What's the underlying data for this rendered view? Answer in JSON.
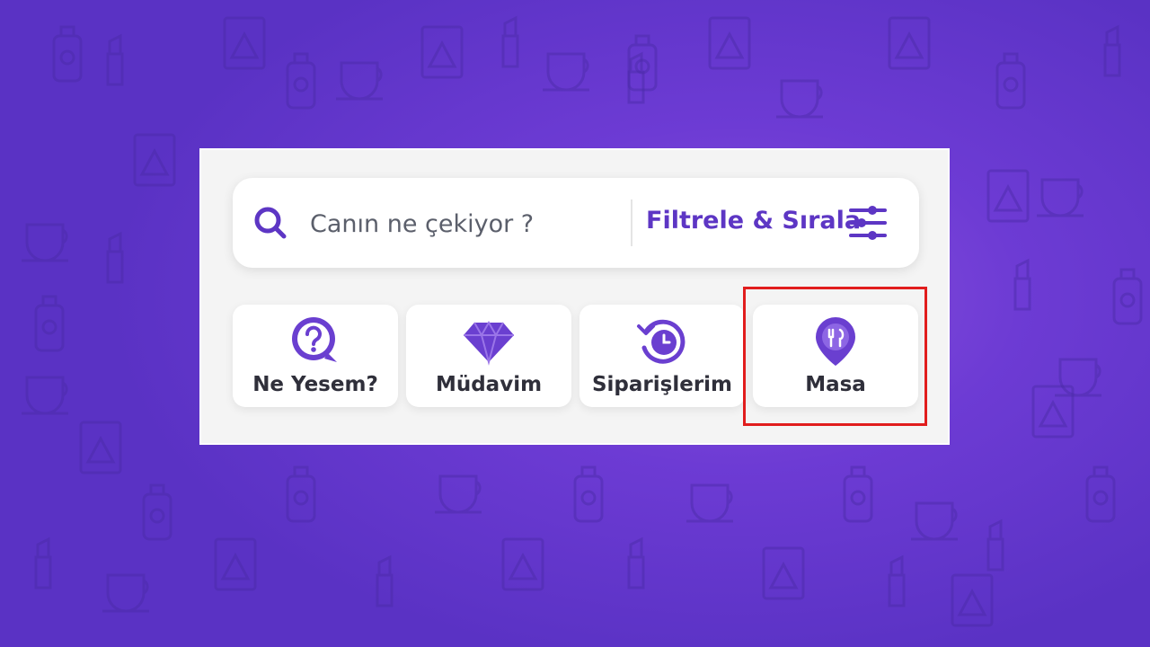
{
  "search": {
    "placeholder": "Canın ne çekiyor ?",
    "filter_label": "Filtrele & Sırala"
  },
  "tiles": [
    {
      "label": "Ne Yesem?",
      "icon": "question-chat-icon"
    },
    {
      "label": "Müdavim",
      "icon": "diamond-icon"
    },
    {
      "label": "Siparişlerim",
      "icon": "history-clock-icon"
    },
    {
      "label": "Masa",
      "icon": "table-location-icon"
    }
  ],
  "colors": {
    "accent": "#5d36c4",
    "background": "#6d3bd4",
    "highlight": "#e11d1d"
  }
}
